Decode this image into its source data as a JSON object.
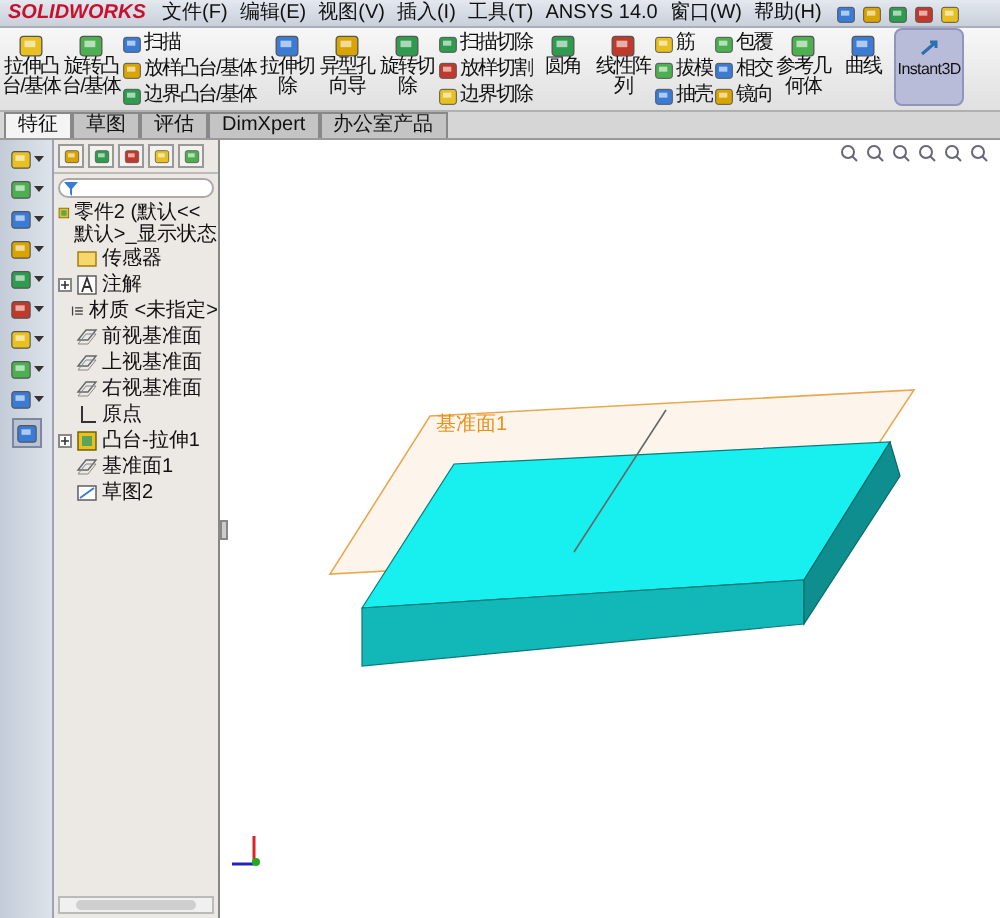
{
  "menu_bar": {
    "logo": "SOLIDWORKS",
    "menus": [
      "文件(F)",
      "编辑(E)",
      "视图(V)",
      "插入(I)",
      "工具(T)",
      "ANSYS 14.0",
      "窗口(W)",
      "帮助(H)"
    ]
  },
  "ribbon": {
    "groups": [
      {
        "kind": "large",
        "items": [
          "拉伸凸台/基体",
          "旋转凸台/基体"
        ]
      },
      {
        "kind": "stack",
        "items": [
          "扫描",
          "放样凸台/基体",
          "边界凸台/基体"
        ]
      },
      {
        "kind": "large",
        "items": [
          "拉伸切除",
          "异型孔向导",
          "旋转切除"
        ]
      },
      {
        "kind": "stack",
        "items": [
          "扫描切除",
          "放样切割",
          "边界切除"
        ]
      },
      {
        "kind": "large",
        "items": [
          "圆角",
          "线性阵列"
        ]
      },
      {
        "kind": "stack",
        "items": [
          "筋",
          "拔模",
          "抽壳"
        ]
      },
      {
        "kind": "stack",
        "items": [
          "包覆",
          "相交",
          "镜向"
        ]
      },
      {
        "kind": "large",
        "items": [
          "参考几何体",
          "曲线"
        ]
      },
      {
        "kind": "toggle",
        "label": "Instant3D",
        "on": true
      }
    ]
  },
  "tabs": [
    {
      "label": "特征",
      "selected": true
    },
    {
      "label": "草图",
      "selected": false
    },
    {
      "label": "评估",
      "selected": false
    },
    {
      "label": "DimXpert",
      "selected": false
    },
    {
      "label": "办公室产品",
      "selected": false
    }
  ],
  "feature_tree": {
    "root": "零件2 (默认<<默认>_显示状态",
    "items": [
      {
        "kind": "sensor",
        "label": "传感器",
        "collapsed": false
      },
      {
        "kind": "annotation",
        "label": "注解",
        "collapsed": true
      },
      {
        "kind": "material",
        "label": "材质 <未指定>",
        "collapsed": false
      },
      {
        "kind": "plane",
        "label": "前视基准面",
        "collapsed": false
      },
      {
        "kind": "plane",
        "label": "上视基准面",
        "collapsed": false
      },
      {
        "kind": "plane",
        "label": "右视基准面",
        "collapsed": false
      },
      {
        "kind": "origin",
        "label": "原点",
        "collapsed": false
      },
      {
        "kind": "feature",
        "label": "凸台-拉伸1",
        "collapsed": true
      },
      {
        "kind": "plane",
        "label": "基准面1",
        "collapsed": false
      },
      {
        "kind": "sketch",
        "label": "草图2",
        "collapsed": false
      }
    ]
  },
  "viewport": {
    "plane_label": "基准面1"
  }
}
